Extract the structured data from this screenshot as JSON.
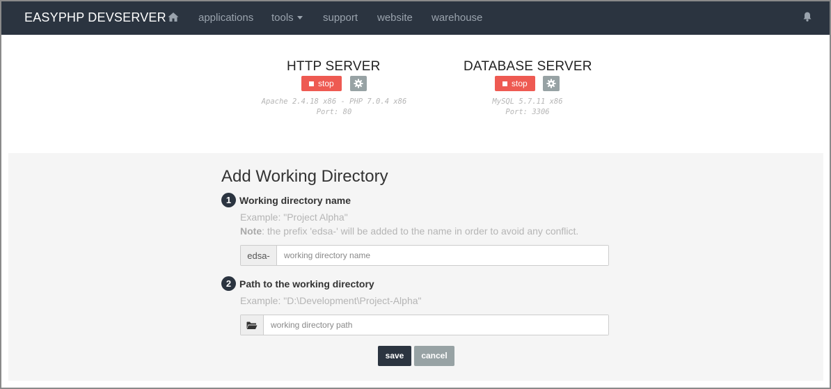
{
  "navbar": {
    "brand": "EASYPHP DEVSERVER",
    "home_icon": "home-icon",
    "links": {
      "applications": "applications",
      "tools": "tools",
      "support": "support",
      "website": "website",
      "warehouse": "warehouse"
    },
    "bell_icon": "bell-icon"
  },
  "servers": {
    "http": {
      "title": "HTTP SERVER",
      "stop_label": "stop",
      "info_line1": "Apache 2.4.18 x86 - PHP 7.0.4 x86",
      "info_line2": "Port: 80"
    },
    "database": {
      "title": "DATABASE SERVER",
      "stop_label": "stop",
      "info_line1": "MySQL 5.7.11 x86",
      "info_line2": "Port: 3306"
    }
  },
  "form": {
    "title": "Add Working Directory",
    "step1": {
      "number": "1",
      "label": "Working directory name",
      "example": "Example: \"Project Alpha\"",
      "note_label": "Note",
      "note_text": ": the prefix 'edsa-' will be added to the name in order to avoid any conflict.",
      "prefix": "edsa-",
      "placeholder": "working directory name",
      "value": ""
    },
    "step2": {
      "number": "2",
      "label": "Path to the working directory",
      "example": "Example: \"D:\\Development\\Project-Alpha\"",
      "placeholder": "working directory path",
      "value": "",
      "addon_icon": "folder-open-icon"
    },
    "save_label": "save",
    "cancel_label": "cancel"
  },
  "colors": {
    "navbar_bg": "#2b3440",
    "stop_red": "#ee5a52",
    "gear_gray": "#97a2a4",
    "panel_bg": "#f5f5f5"
  }
}
